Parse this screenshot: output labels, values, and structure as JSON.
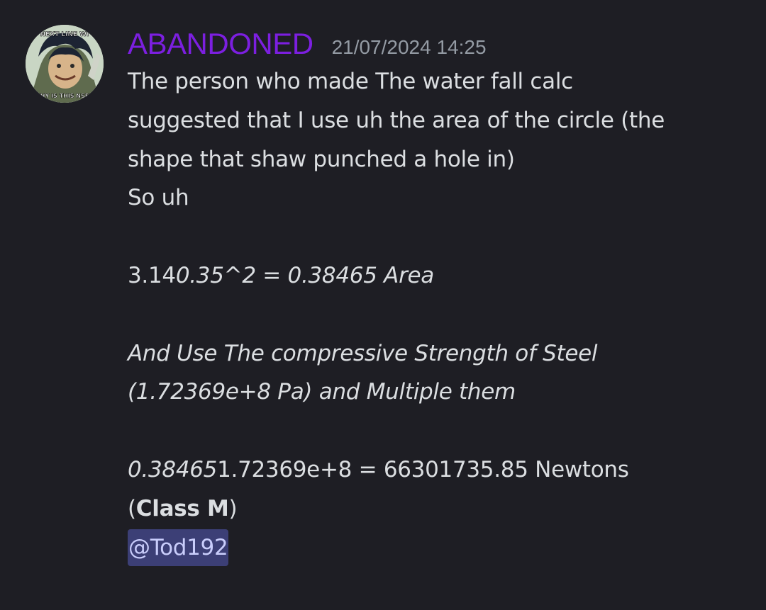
{
  "message": {
    "author": "ABANDONED",
    "timestamp": "21/07/2024 14:25",
    "avatar": {
      "top_text": "NEXT LINE WI",
      "bottom_text": "WHY IS THIS NSFW"
    },
    "lines": {
      "l1": "The person who made The water fall calc",
      "l2": "suggested that I use uh the area of the circle (the",
      "l3": "shape that shaw punched a hole in)",
      "l4": "So uh",
      "l5a": "3.14",
      "l5b": "0.35^2 = 0.38465 Area",
      "l6": "And Use The compressive Strength of Steel",
      "l7": "(1.72369e+8 Pa) and Multiple them",
      "l8a": "0.38465",
      "l8b": "1.72369e+8 = 66301735.85 Newtons",
      "l9_open": "(",
      "l9_bold": "Class M",
      "l9_close": ")"
    },
    "mention": "@Tod192"
  },
  "colors": {
    "background": "#1e1e24",
    "username": "#7c1fe0",
    "timestamp": "#949ba4",
    "text": "#dbdee1",
    "mention_bg": "#3c3f76",
    "mention_text": "#c9cdfb"
  }
}
